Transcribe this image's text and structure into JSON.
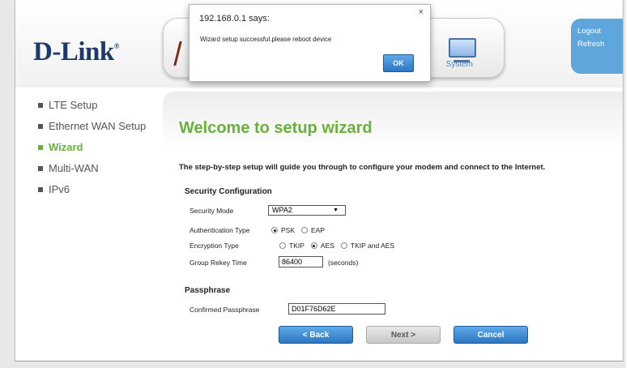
{
  "header": {
    "logo_text": "D-Link",
    "logo_reg": "®",
    "nav_system_label": "System",
    "logout_label": "Logout",
    "refresh_label": "Refresh"
  },
  "sidebar": {
    "items": [
      {
        "label": "LTE Setup"
      },
      {
        "label": "Ethernet WAN Setup"
      },
      {
        "label": "Wizard"
      },
      {
        "label": "Multi-WAN"
      },
      {
        "label": "IPv6"
      }
    ]
  },
  "main": {
    "title": "Welcome to setup wizard",
    "intro": "The step-by-step setup will guide you through to configure your modem and connect to the Internet.",
    "security": {
      "heading": "Security Configuration",
      "mode_label": "Security Mode",
      "mode_value": "WPA2",
      "auth_label": "Authentication Type",
      "auth_options": [
        "PSK",
        "EAP"
      ],
      "enc_label": "Encryption Type",
      "enc_options": [
        "TKIP",
        "AES",
        "TKIP and AES"
      ],
      "rekey_label": "Group Rekey Time",
      "rekey_value": "86400",
      "rekey_unit": "(seconds)"
    },
    "passphrase": {
      "heading": "Passphrase",
      "confirmed_label": "Confirmed Passphrase",
      "confirmed_value": "D01F76D62E"
    },
    "buttons": {
      "back": "< Back",
      "next": "Next >",
      "cancel": "Cancel"
    }
  },
  "dialog": {
    "title": "192.168.0.1 says:",
    "message": "Wizard setup successful.please reboot device",
    "ok_label": "OK",
    "close_glyph": "×"
  }
}
